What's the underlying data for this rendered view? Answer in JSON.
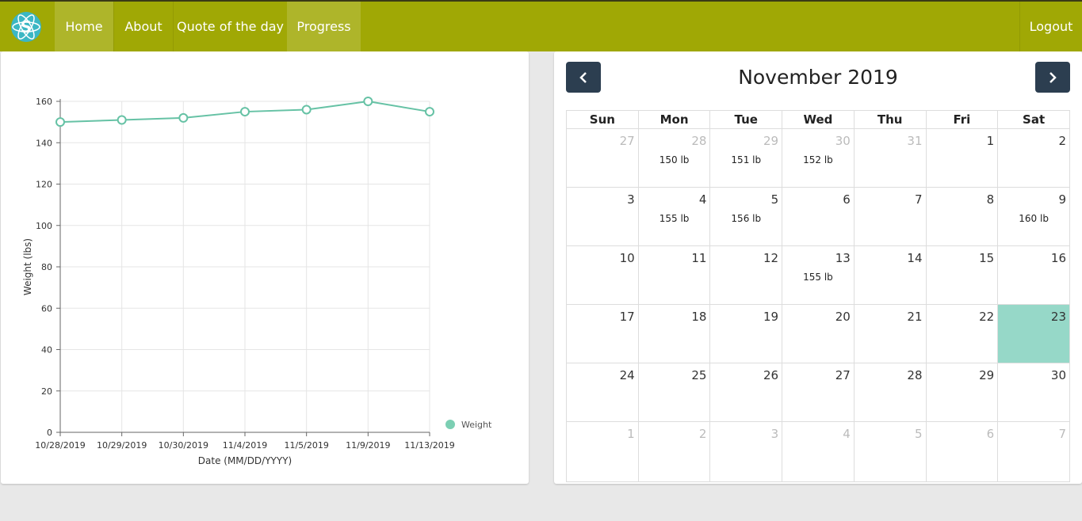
{
  "nav": {
    "items": [
      {
        "label": "Home",
        "active": true
      },
      {
        "label": "About",
        "active": false
      },
      {
        "label": "Quote of the day",
        "active": false
      },
      {
        "label": "Progress",
        "active": true
      }
    ],
    "logout_label": "Logout",
    "brand_color": "#a0a805"
  },
  "chart_data": {
    "type": "line",
    "categories": [
      "10/28/2019",
      "10/29/2019",
      "10/30/2019",
      "11/4/2019",
      "11/5/2019",
      "11/9/2019",
      "11/13/2019"
    ],
    "series": [
      {
        "name": "Weight",
        "values": [
          150,
          151,
          152,
          155,
          156,
          160,
          155
        ],
        "color": "#66c2a5"
      }
    ],
    "xlabel": "Date (MM/DD/YYYY)",
    "ylabel": "Weight (lbs)",
    "ylim": [
      0,
      160
    ],
    "yticks": [
      0,
      20,
      40,
      60,
      80,
      100,
      120,
      140,
      160
    ],
    "grid": true,
    "legend": "bottom-right"
  },
  "calendar": {
    "title": "November 2019",
    "prev_icon": "chevron-left-icon",
    "next_icon": "chevron-right-icon",
    "weekdays": [
      "Sun",
      "Mon",
      "Tue",
      "Wed",
      "Thu",
      "Fri",
      "Sat"
    ],
    "weeks": [
      [
        {
          "day": "27",
          "other": true
        },
        {
          "day": "28",
          "other": true,
          "event": "150 lb"
        },
        {
          "day": "29",
          "other": true,
          "event": "151 lb"
        },
        {
          "day": "30",
          "other": true,
          "event": "152 lb"
        },
        {
          "day": "31",
          "other": true
        },
        {
          "day": "1"
        },
        {
          "day": "2"
        }
      ],
      [
        {
          "day": "3"
        },
        {
          "day": "4",
          "event": "155 lb"
        },
        {
          "day": "5",
          "event": "156 lb"
        },
        {
          "day": "6"
        },
        {
          "day": "7"
        },
        {
          "day": "8"
        },
        {
          "day": "9",
          "event": "160 lb"
        }
      ],
      [
        {
          "day": "10"
        },
        {
          "day": "11"
        },
        {
          "day": "12"
        },
        {
          "day": "13",
          "event": "155 lb"
        },
        {
          "day": "14"
        },
        {
          "day": "15"
        },
        {
          "day": "16"
        }
      ],
      [
        {
          "day": "17"
        },
        {
          "day": "18"
        },
        {
          "day": "19"
        },
        {
          "day": "20"
        },
        {
          "day": "21"
        },
        {
          "day": "22"
        },
        {
          "day": "23",
          "today": true
        }
      ],
      [
        {
          "day": "24"
        },
        {
          "day": "25"
        },
        {
          "day": "26"
        },
        {
          "day": "27"
        },
        {
          "day": "28"
        },
        {
          "day": "29"
        },
        {
          "day": "30"
        }
      ],
      [
        {
          "day": "1",
          "other": true
        },
        {
          "day": "2",
          "other": true
        },
        {
          "day": "3",
          "other": true
        },
        {
          "day": "4",
          "other": true
        },
        {
          "day": "5",
          "other": true
        },
        {
          "day": "6",
          "other": true
        },
        {
          "day": "7",
          "other": true
        }
      ]
    ],
    "today_color": "#96d8c8"
  }
}
